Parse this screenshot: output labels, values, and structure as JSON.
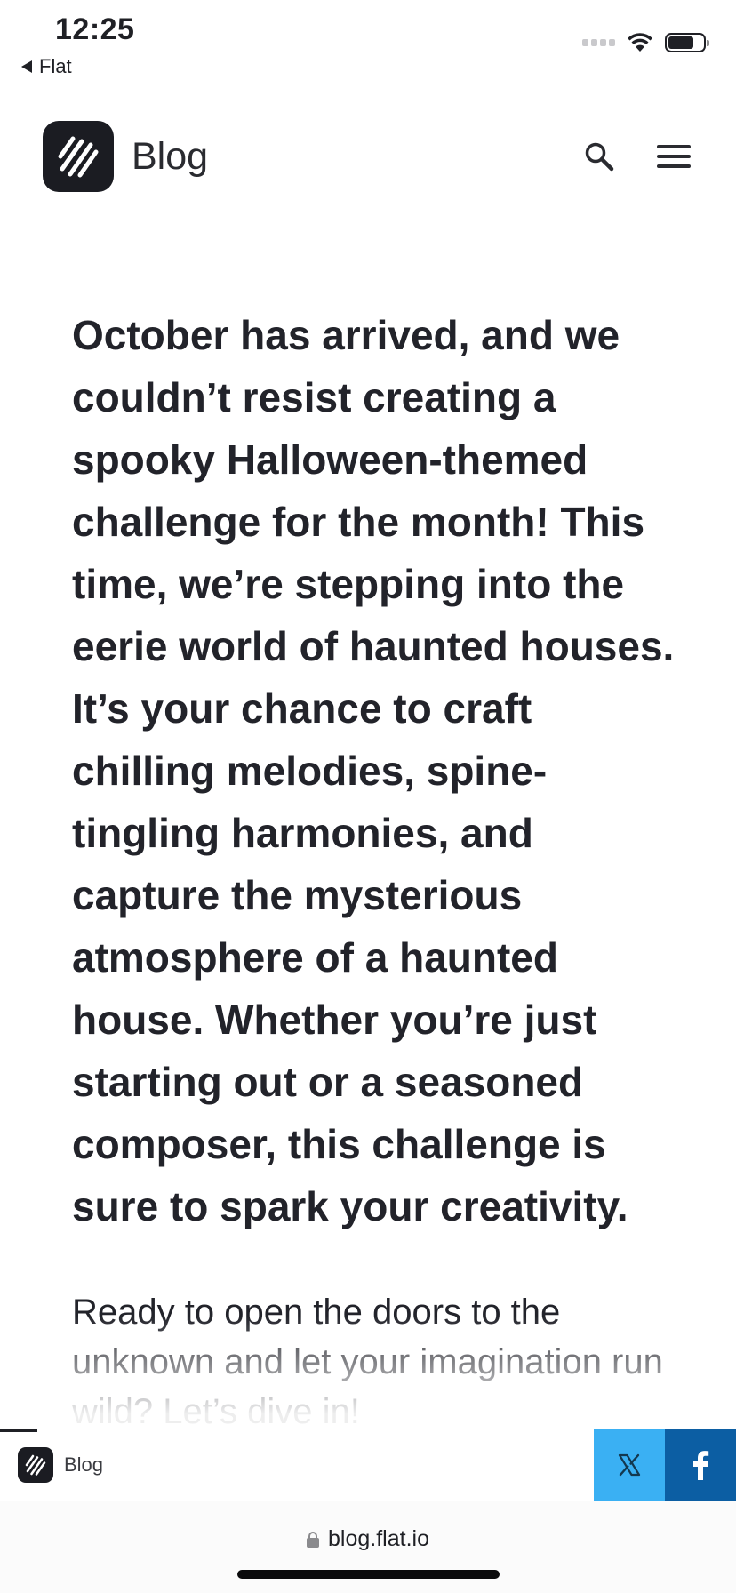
{
  "status_bar": {
    "time": "12:25",
    "back_label": "Flat"
  },
  "header": {
    "site_title": "Blog",
    "logo_icon": "flat-logo-icon",
    "actions": [
      "search-icon",
      "menu-icon"
    ]
  },
  "article": {
    "lead": "October has arrived, and we couldn’t resist creating a spooky Halloween-themed challenge for the month! This time, we’re stepping into the eerie world of haunted houses. It’s your chance to craft chilling melodies, spine-tingling harmonies, and capture the mysterious atmosphere of a haunted house. Whether you’re just starting out or a seasoned composer, this challenge is sure to spark your creativity.",
    "paragraph": "Ready to open the doors to the unknown and let your imagination run wild? Let’s dive in!"
  },
  "share_bar": {
    "brand_label": "Blog",
    "buttons": [
      "x-icon",
      "facebook-icon"
    ],
    "colors": {
      "x": "#3ab0f3",
      "facebook": "#0c5ea3"
    }
  },
  "url_bar": {
    "url": "blog.flat.io"
  }
}
